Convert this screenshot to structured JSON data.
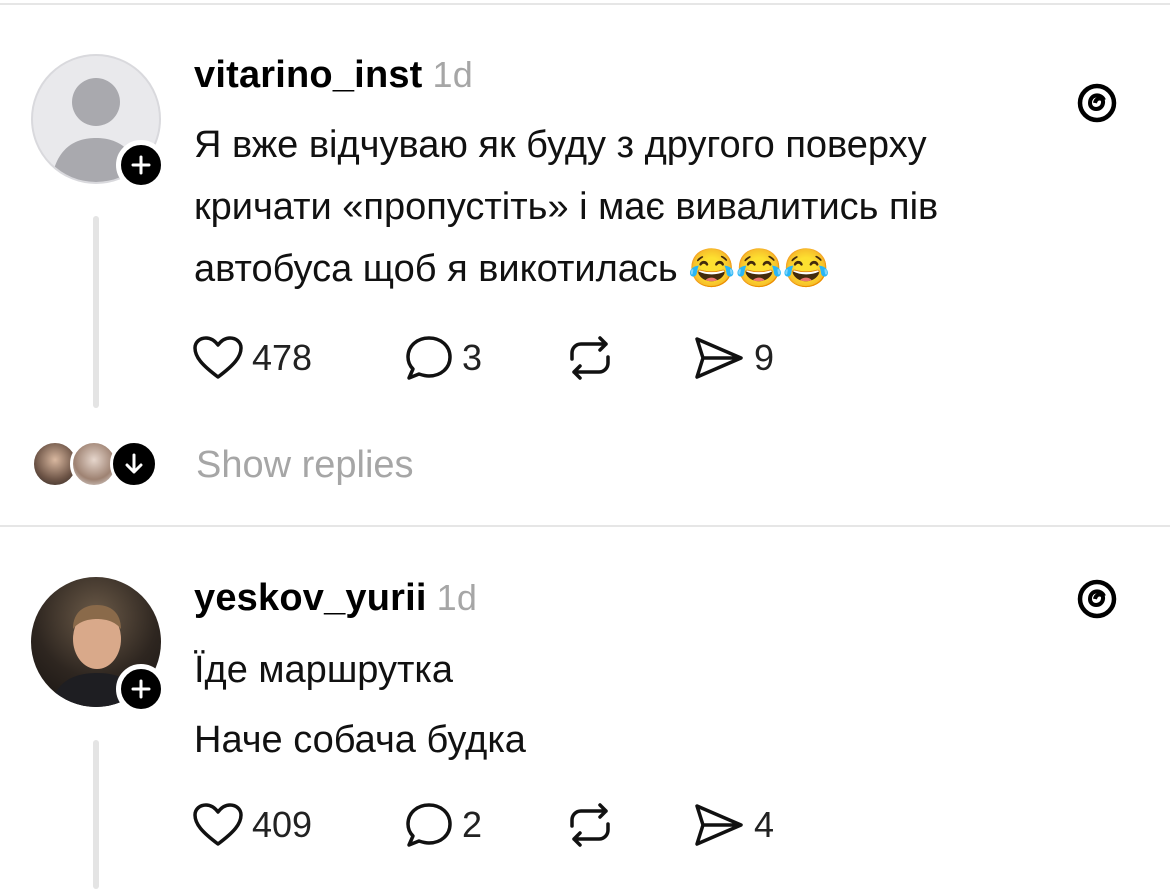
{
  "posts": [
    {
      "username": "vitarino_inst",
      "time": "1d",
      "lines": [
        "Я вже відчуваю як буду з другого поверху",
        "кричати «пропустіть» і має вивалитись пів",
        "автобуса щоб я викотилась 😂😂😂"
      ],
      "likes": "478",
      "comments": "3",
      "shares": "9"
    },
    {
      "username": "yeskov_yurii",
      "time": "1d",
      "lines": [
        "Їде маршрутка",
        "Наче собача будка"
      ],
      "likes": "409",
      "comments": "2",
      "shares": "4"
    }
  ],
  "show_replies": "Show replies",
  "icons": [
    "person-placeholder-icon",
    "plus-icon",
    "threads-logo-icon",
    "heart-icon",
    "comment-icon",
    "repost-icon",
    "send-icon",
    "arrow-down-icon"
  ]
}
